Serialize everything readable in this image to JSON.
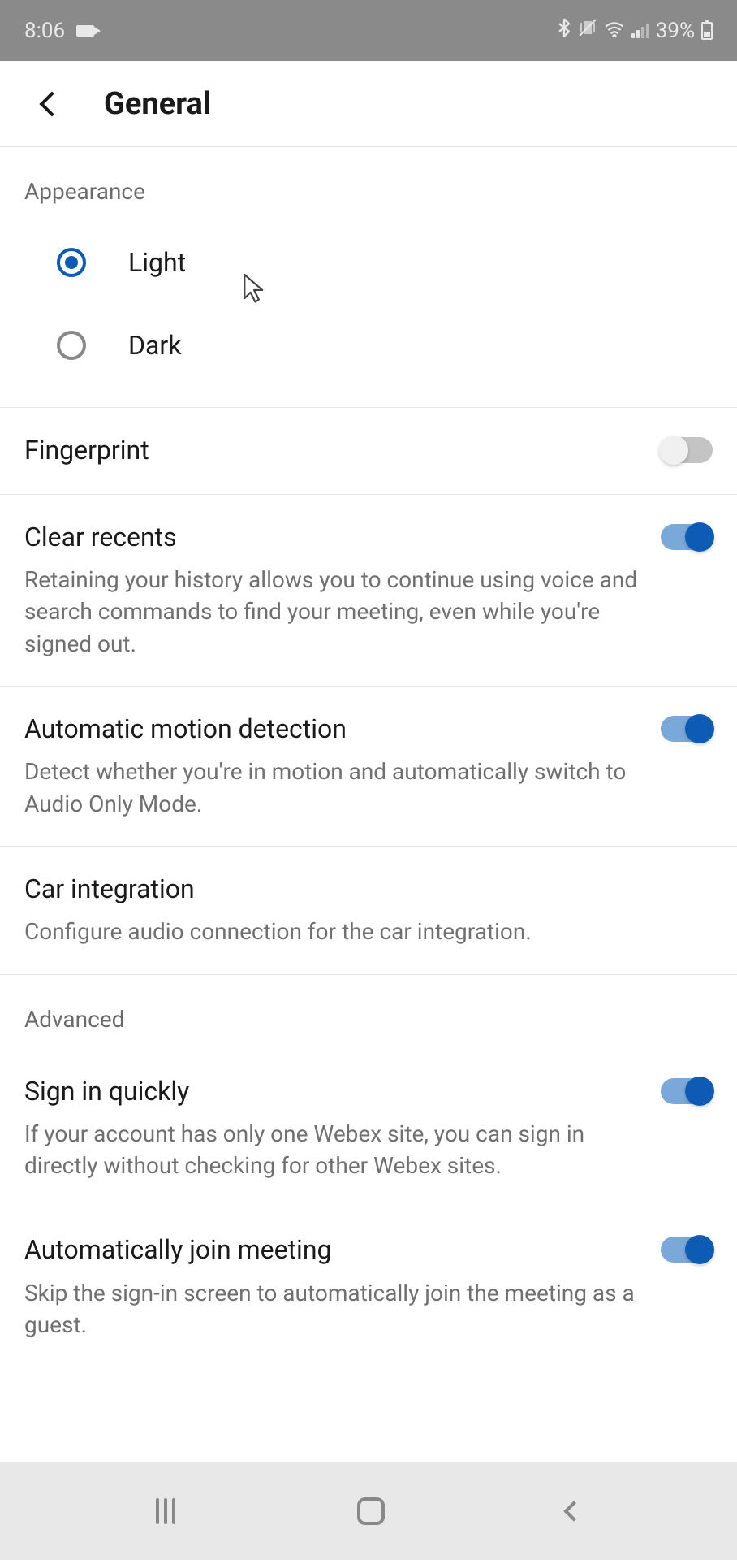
{
  "statusBar": {
    "time": "8:06",
    "battery": "39%"
  },
  "header": {
    "title": "General"
  },
  "sections": {
    "appearance": {
      "label": "Appearance",
      "options": {
        "light": "Light",
        "dark": "Dark"
      },
      "selected": "light"
    },
    "advanced": {
      "label": "Advanced"
    }
  },
  "settings": {
    "fingerprint": {
      "title": "Fingerprint",
      "enabled": false
    },
    "clearRecents": {
      "title": "Clear recents",
      "description": "Retaining your history allows you to continue using voice and search commands to find your meeting, even while you're signed out.",
      "enabled": true
    },
    "motionDetection": {
      "title": "Automatic motion detection",
      "description": "Detect whether you're in motion and automatically switch to Audio Only Mode.",
      "enabled": true
    },
    "carIntegration": {
      "title": "Car integration",
      "description": "Configure audio connection for the car integration."
    },
    "signInQuickly": {
      "title": "Sign in quickly",
      "description": "If your account has only one Webex site, you can sign in directly without checking for other Webex sites.",
      "enabled": true
    },
    "autoJoin": {
      "title": "Automatically join meeting",
      "description": "Skip the sign-in screen to automatically join the meeting as a guest.",
      "enabled": true
    }
  }
}
